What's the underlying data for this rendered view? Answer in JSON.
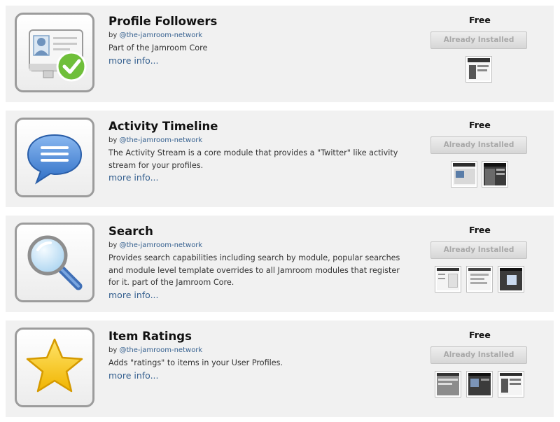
{
  "modules": [
    {
      "title": "Profile Followers",
      "by_prefix": "by",
      "author": "@the-jamroom-network",
      "description": "Part of the Jamroom Core",
      "more": "more info...",
      "price": "Free",
      "button": "Already Installed",
      "icon": "profile-followers-icon"
    },
    {
      "title": "Activity Timeline",
      "by_prefix": "by",
      "author": "@the-jamroom-network",
      "description": "The Activity Stream is a core module that provides a \"Twitter\" like activity stream for your profiles.",
      "more": "more info...",
      "price": "Free",
      "button": "Already Installed",
      "icon": "speech-bubble-icon"
    },
    {
      "title": "Search",
      "by_prefix": "by",
      "author": "@the-jamroom-network",
      "description": "Provides search capabilities including search by module, popular searches and module level template overrides to all Jamroom modules that register for it. part of the Jamroom Core.",
      "more": "more info...",
      "price": "Free",
      "button": "Already Installed",
      "icon": "magnifier-icon"
    },
    {
      "title": "Item Ratings",
      "by_prefix": "by",
      "author": "@the-jamroom-network",
      "description": "Adds \"ratings\" to items in your User Profiles.",
      "more": "more info...",
      "price": "Free",
      "button": "Already Installed",
      "icon": "star-icon"
    }
  ],
  "colors": {
    "card_bg": "#f1f1f1",
    "link": "#35608f",
    "button_text": "#a8a8a8",
    "icon_border": "#9c9c9c"
  }
}
